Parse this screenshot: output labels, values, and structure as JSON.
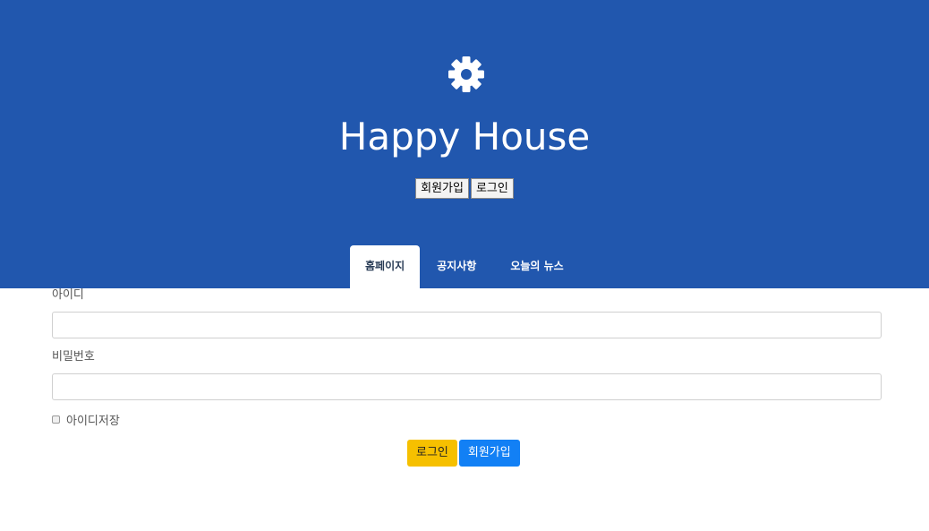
{
  "header": {
    "icon": "gear-icon",
    "title": "Happy House",
    "signup_label": "회원가입",
    "login_label": "로그인",
    "background": "#2157ae"
  },
  "tabs": [
    {
      "label": "홈페이지",
      "active": true
    },
    {
      "label": "공지사항",
      "active": false
    },
    {
      "label": "오늘의 뉴스",
      "active": false
    }
  ],
  "form": {
    "id_label": "아이디",
    "id_value": "",
    "password_label": "비밀번호",
    "password_value": "",
    "remember_label": "아이디저장",
    "remember_checked": false,
    "login_button": "로그인",
    "signup_button": "회원가입"
  },
  "colors": {
    "login_button": "#f6c000",
    "signup_button": "#1280f5"
  }
}
